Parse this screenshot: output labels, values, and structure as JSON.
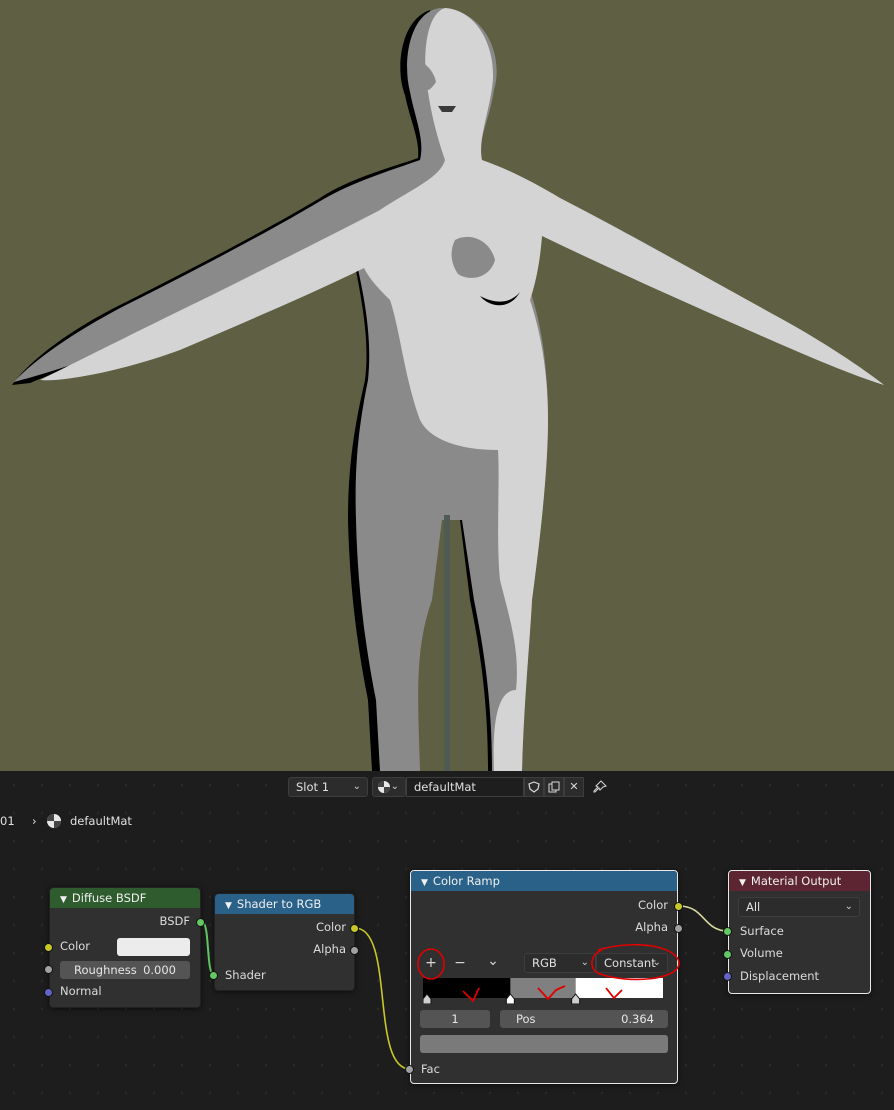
{
  "header": {
    "slot_label": "Slot 1",
    "material_name": "defaultMat"
  },
  "breadcrumb": {
    "prefix": "01",
    "separator": "›",
    "material": "defaultMat"
  },
  "nodes": {
    "diffuse": {
      "title": "Diffuse BSDF",
      "out_bsdf": "BSDF",
      "in_color": "Color",
      "roughness_label": "Roughness",
      "roughness_value": "0.000",
      "in_normal": "Normal",
      "color_value": "#ececec"
    },
    "shader_to_rgb": {
      "title": "Shader to RGB",
      "out_color": "Color",
      "out_alpha": "Alpha",
      "in_shader": "Shader"
    },
    "color_ramp": {
      "title": "Color Ramp",
      "out_color": "Color",
      "out_alpha": "Alpha",
      "add_button": "+",
      "remove_button": "−",
      "menu_button": "⌄",
      "color_mode": "RGB",
      "interpolation": "Constant",
      "stop_index": "1",
      "pos_label": "Pos",
      "pos_value": "0.364",
      "in_fac": "Fac",
      "stops": [
        {
          "position": 0.0,
          "color": "#000000"
        },
        {
          "position": 0.364,
          "color": "#808080"
        },
        {
          "position": 0.636,
          "color": "#ffffff"
        }
      ]
    },
    "material_output": {
      "title": "Material Output",
      "target": "All",
      "in_surface": "Surface",
      "in_volume": "Volume",
      "in_displacement": "Displacement"
    }
  },
  "colors": {
    "viewport_bg": "#5f5f43",
    "annotation": "#e00000",
    "node_header_shader": "#2e5c2e",
    "node_header_converter": "#2a6188",
    "node_header_output": "#5c2531"
  }
}
